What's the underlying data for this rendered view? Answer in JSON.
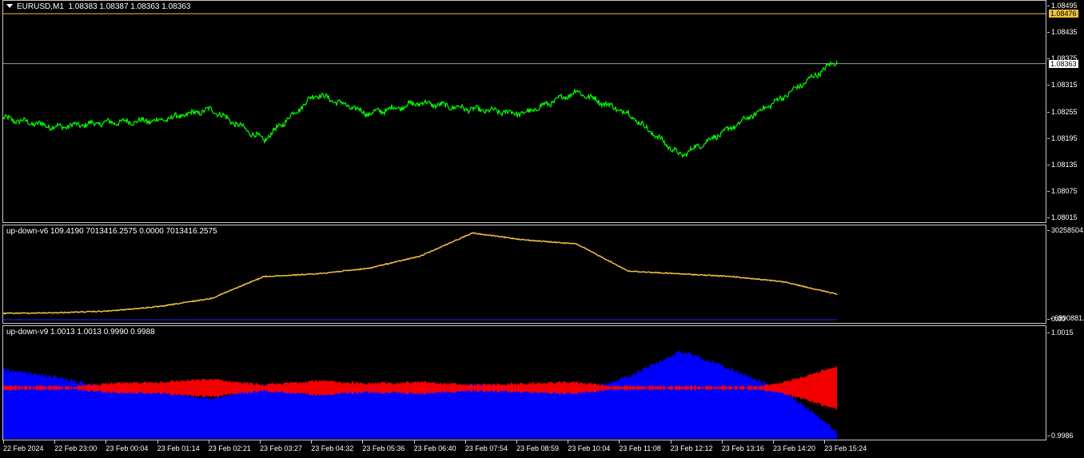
{
  "main": {
    "title": "EURUSD,M1  1.08383 1.08387 1.08363 1.08363",
    "ticks": [
      "1.08495",
      "1.08435",
      "1.08375",
      "1.08315",
      "1.08255",
      "1.08195",
      "1.08135",
      "1.08075",
      "1.08015"
    ],
    "tick_values": [
      1.08495,
      1.08435,
      1.08375,
      1.08315,
      1.08255,
      1.08195,
      1.08135,
      1.08075,
      1.08015
    ],
    "hline_ask": "1.08476",
    "hline_ask_value": 1.08476,
    "bid": "1.08363",
    "bid_value": 1.08363,
    "ask_color": "#f0c040",
    "line_color": "#00ff00"
  },
  "ind1": {
    "title": "up-down-v6 109.4190 7013416.2575 0.0000 7013416.2575",
    "ticks": [
      "30258504.",
      "0.00"
    ],
    "tick_overlap": "6890881.",
    "line_color": "#f0c040",
    "base_color": "#2020ff"
  },
  "ind2": {
    "title": "up-down-v9 1.0013 1.0013 0.9990 0.9988",
    "ticks": [
      "1.0015",
      "0.9986"
    ],
    "color_up": "#0000ff",
    "color_down": "#ff0000"
  },
  "xaxis": {
    "labels": [
      "22 Feb 2024",
      "22 Feb 23:00",
      "23 Feb 00:04",
      "23 Feb 01:14",
      "23 Feb 02:21",
      "23 Feb 03:27",
      "23 Feb 04:32",
      "23 Feb 05:36",
      "23 Feb 06:40",
      "23 Feb 07:54",
      "23 Feb 08:59",
      "23 Feb 10:04",
      "23 Feb 11:08",
      "23 Feb 12:12",
      "23 Feb 13:16",
      "23 Feb 14:20",
      "23 Feb 15:24"
    ]
  },
  "chart_data": [
    {
      "type": "line",
      "title": "EURUSD,M1  1.08383 1.08387 1.08363 1.08363",
      "x": [
        "22 Feb 2024",
        "22 Feb 23:00",
        "23 Feb 00:04",
        "23 Feb 01:14",
        "23 Feb 02:21",
        "23 Feb 03:27",
        "23 Feb 04:32",
        "23 Feb 05:36",
        "23 Feb 06:40",
        "23 Feb 07:54",
        "23 Feb 08:59",
        "23 Feb 10:04",
        "23 Feb 11:08",
        "23 Feb 12:12",
        "23 Feb 13:16",
        "23 Feb 14:20",
        "23 Feb 15:24"
      ],
      "values": [
        1.0824,
        1.0822,
        1.0823,
        1.08235,
        1.0826,
        1.0819,
        1.08295,
        1.0825,
        1.08275,
        1.0826,
        1.0825,
        1.083,
        1.0825,
        1.08155,
        1.0822,
        1.0829,
        1.0837
      ],
      "ylim": [
        1.08005,
        1.08505
      ]
    },
    {
      "type": "line",
      "title": "up-down-v6 109.4190 7013416.2575 0.0000 7013416.2575",
      "x": [
        "22 Feb 2024",
        "22 Feb 23:00",
        "23 Feb 00:04",
        "23 Feb 01:14",
        "23 Feb 02:21",
        "23 Feb 03:27",
        "23 Feb 04:32",
        "23 Feb 05:36",
        "23 Feb 06:40",
        "23 Feb 07:54",
        "23 Feb 08:59",
        "23 Feb 10:04",
        "23 Feb 11:08",
        "23 Feb 12:12",
        "23 Feb 13:16",
        "23 Feb 14:20",
        "23 Feb 15:24"
      ],
      "values": [
        0,
        200000,
        800000,
        2500000,
        5500000,
        13500000,
        14500000,
        16500000,
        21000000,
        29500000,
        27000000,
        25500000,
        15500000,
        14500000,
        13500000,
        11500000,
        7013416
      ],
      "ylim": [
        0,
        30258504
      ]
    },
    {
      "type": "bar",
      "title": "up-down-v9 1.0013 1.0013 0.9990 0.9988",
      "x": [
        "22 Feb 2024",
        "22 Feb 23:00",
        "23 Feb 00:04",
        "23 Feb 01:14",
        "23 Feb 02:21",
        "23 Feb 03:27",
        "23 Feb 04:32",
        "23 Feb 05:36",
        "23 Feb 06:40",
        "23 Feb 07:54",
        "23 Feb 08:59",
        "23 Feb 10:04",
        "23 Feb 11:08",
        "23 Feb 12:12",
        "23 Feb 13:16",
        "23 Feb 14:20",
        "23 Feb 15:24"
      ],
      "values": [
        1.0005,
        1.0003,
        1.0,
        0.9999,
        0.9997,
        1.0001,
        0.9998,
        1.0,
        0.9999,
        1.0001,
        1.0,
        0.9999,
        1.0003,
        1.001,
        1.0005,
        0.9999,
        0.9988
      ],
      "ylim": [
        0.9986,
        1.0015
      ]
    }
  ]
}
